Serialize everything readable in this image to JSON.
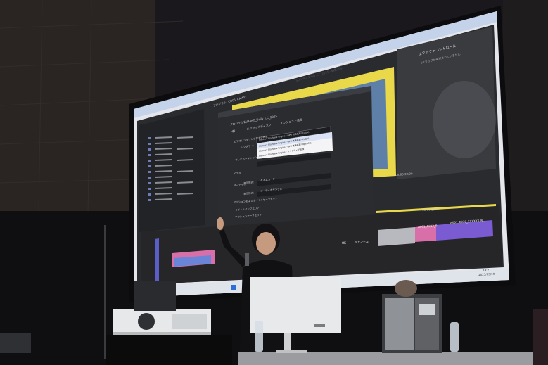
{
  "screen": {
    "window_title": "SURAKO_Daily_CC_2025 - 編集済み",
    "tab_program": "プログラム: CD05_CAM01",
    "effect_controls": "エフェクトコントロール",
    "effect_note": "(クリップが選択されていません)",
    "timecode_left": "00;00;30;00",
    "timecode_right": "00;00;30;00",
    "timeline_clips": [
      "A001_C013_0...",
      "A001_C038_XXXXXX_R..."
    ]
  },
  "dialog": {
    "project_label": "プロジェクト:",
    "project_name": "SURAKO_Daily_CC_2025",
    "tab_general": "一般",
    "tab_scratch": "スクラッチディスク",
    "tab_ingest": "インジェスト設定",
    "renderer_section": "ビデオレンダリングおよび再生",
    "renderer_label": "レンダラー:",
    "renderer_value": "Mercury Playback Engine - GPU 高速処理 (CUDA)",
    "renderer_options": [
      "Mercury Playback Engine - GPU 高速処理 (CUDA)",
      "Mercury Playback Engine - GPU 高速処理 (OpenCL)",
      "Mercury Playback Engine - ソフトウェア処理"
    ],
    "preview_label": "プレビューキャッシュ:",
    "video_label": "ビデオ",
    "display_format_label": "表示形式:",
    "display_format_value": "タイムコード",
    "audio_label": "オーディオ",
    "audio_format_label": "表示形式:",
    "audio_format_value": "オーディオサンプル",
    "action_safe": "アクションおよびタイトルセーフエリア",
    "title_safe": "タイトルセーフエリア",
    "action_safe2": "アクションセーフエリア",
    "ok_label": "OK",
    "cancel_label": "キャンセル"
  },
  "taskbar": {
    "time": "14:27",
    "date": "2025/03/19"
  },
  "colors": {
    "screen_bg": "#e4e6ec",
    "dialog_bg": "#2b2c30",
    "accent_blue": "#2d6ed8",
    "yellow_frame": "#e9d84a",
    "timeline_pink": "#d96fa9",
    "timeline_purple": "#7b5bd1"
  }
}
